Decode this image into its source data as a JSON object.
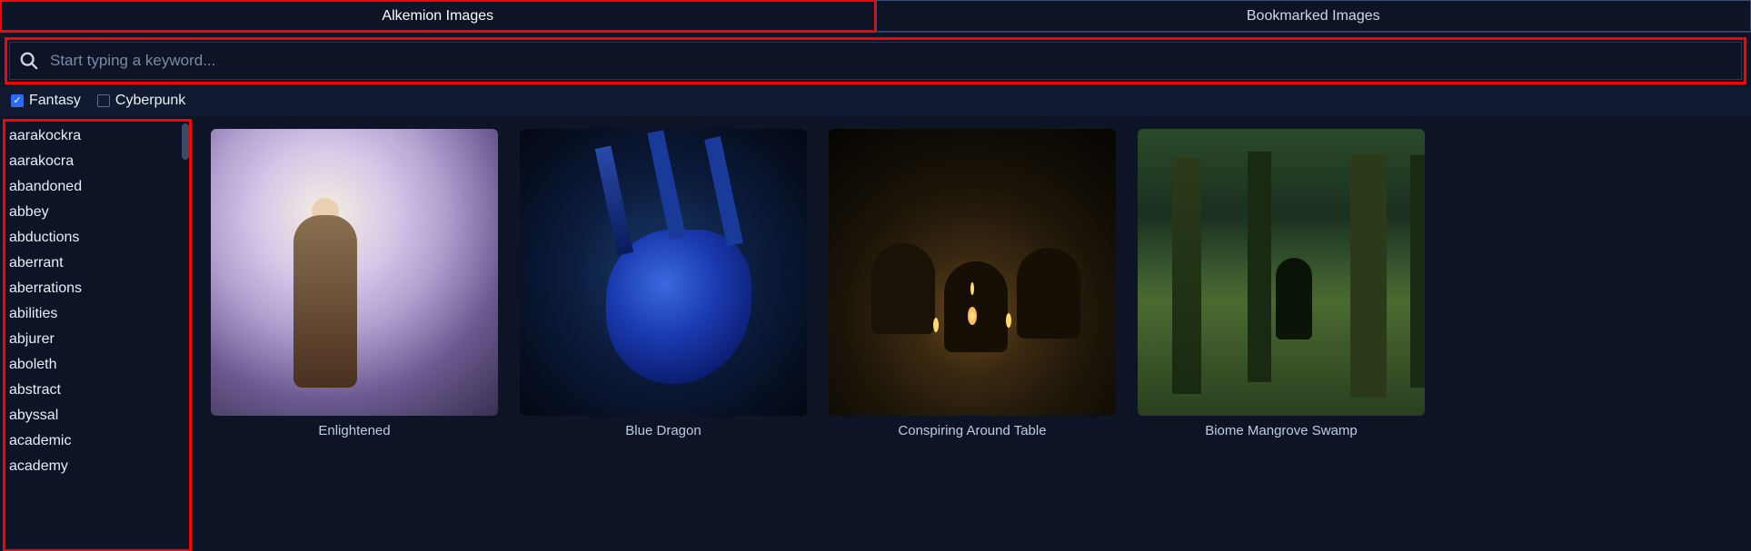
{
  "tabs": {
    "alkemion": "Alkemion Images",
    "bookmarked": "Bookmarked Images"
  },
  "search": {
    "placeholder": "Start typing a keyword..."
  },
  "filters": {
    "fantasy": {
      "label": "Fantasy",
      "checked": true
    },
    "cyberpunk": {
      "label": "Cyberpunk",
      "checked": false
    }
  },
  "keywords": [
    "aarakockra",
    "aarakocra",
    "abandoned",
    "abbey",
    "abductions",
    "aberrant",
    "aberrations",
    "abilities",
    "abjurer",
    "aboleth",
    "abstract",
    "abyssal",
    "academic",
    "academy"
  ],
  "gallery": [
    {
      "title": "Enlightened"
    },
    {
      "title": "Blue Dragon"
    },
    {
      "title": "Conspiring Around Table"
    },
    {
      "title": "Biome Mangrove Swamp"
    }
  ]
}
